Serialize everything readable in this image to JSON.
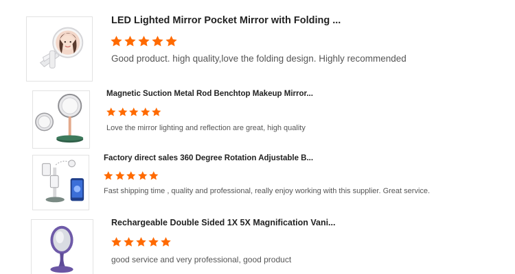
{
  "colors": {
    "star": "#ff6a00",
    "title": "#222222",
    "comment": "#555555",
    "border": "#e2e2e2"
  },
  "reviews": [
    {
      "product_title": "LED Lighted Mirror Pocket Mirror with Folding ...",
      "rating": 5,
      "comment": "Good product. high quality,love the folding design. Highly recommended",
      "thumbnail_icon": "folding-led-pocket-mirror"
    },
    {
      "product_title": "Magnetic Suction Metal Rod Benchtop Makeup Mirror...",
      "rating": 5,
      "comment": "Love the mirror lighting and reflection are great, high quality",
      "thumbnail_icon": "benchtop-makeup-mirror"
    },
    {
      "product_title": "Factory direct sales 360 Degree Rotation Adjustable B...",
      "rating": 5,
      "comment": "Fast shipping time , quality and professional, really enjoy working with this supplier. Great service.",
      "thumbnail_icon": "rotating-mirror-with-phone"
    },
    {
      "product_title": "Rechargeable Double Sided 1X 5X Magnification Vani...",
      "rating": 5,
      "comment": "good service and very professional, good product",
      "thumbnail_icon": "double-sided-vanity-mirror"
    }
  ]
}
